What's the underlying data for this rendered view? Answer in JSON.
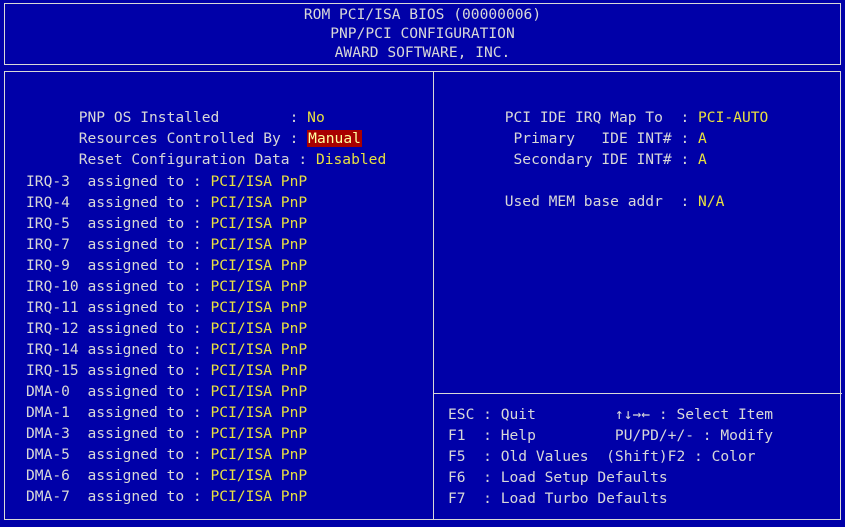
{
  "header": {
    "line1": "ROM PCI/ISA BIOS (00000006)",
    "line2": "PNP/PCI CONFIGURATION",
    "line3": "AWARD SOFTWARE, INC."
  },
  "left": {
    "pnp_os_label": "PNP OS Installed        : ",
    "pnp_os_value": "No",
    "resources_label": "Resources Controlled By : ",
    "resources_value": "Manual",
    "reset_label": "Reset Configuration Data : ",
    "reset_value": "Disabled",
    "assignments": [
      {
        "label": "IRQ-3  assigned to : ",
        "value": "PCI/ISA PnP"
      },
      {
        "label": "IRQ-4  assigned to : ",
        "value": "PCI/ISA PnP"
      },
      {
        "label": "IRQ-5  assigned to : ",
        "value": "PCI/ISA PnP"
      },
      {
        "label": "IRQ-7  assigned to : ",
        "value": "PCI/ISA PnP"
      },
      {
        "label": "IRQ-9  assigned to : ",
        "value": "PCI/ISA PnP"
      },
      {
        "label": "IRQ-10 assigned to : ",
        "value": "PCI/ISA PnP"
      },
      {
        "label": "IRQ-11 assigned to : ",
        "value": "PCI/ISA PnP"
      },
      {
        "label": "IRQ-12 assigned to : ",
        "value": "PCI/ISA PnP"
      },
      {
        "label": "IRQ-14 assigned to : ",
        "value": "PCI/ISA PnP"
      },
      {
        "label": "IRQ-15 assigned to : ",
        "value": "PCI/ISA PnP"
      },
      {
        "label": "DMA-0  assigned to : ",
        "value": "PCI/ISA PnP"
      },
      {
        "label": "DMA-1  assigned to : ",
        "value": "PCI/ISA PnP"
      },
      {
        "label": "DMA-3  assigned to : ",
        "value": "PCI/ISA PnP"
      },
      {
        "label": "DMA-5  assigned to : ",
        "value": "PCI/ISA PnP"
      },
      {
        "label": "DMA-6  assigned to : ",
        "value": "PCI/ISA PnP"
      },
      {
        "label": "DMA-7  assigned to : ",
        "value": "PCI/ISA PnP"
      }
    ]
  },
  "right": {
    "irq_map_label": "PCI IDE IRQ Map To  : ",
    "irq_map_value": "PCI-AUTO",
    "primary_label": " Primary   IDE INT# : ",
    "primary_value": "A",
    "secondary_label": " Secondary IDE INT# : ",
    "secondary_value": "A",
    "mem_base_label": "Used MEM base addr  : ",
    "mem_base_value": "N/A"
  },
  "help": {
    "line1": "ESC : Quit         ↑↓→← : Select Item",
    "line2": "F1  : Help         PU/PD/+/- : Modify",
    "line3": "F5  : Old Values  (Shift)F2 : Color",
    "line4": "F6  : Load Setup Defaults",
    "line5": "F7  : Load Turbo Defaults"
  }
}
